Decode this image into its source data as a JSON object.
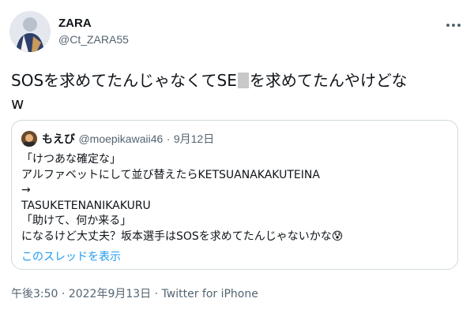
{
  "author": {
    "display_name": "ZARA",
    "handle": "@Ct_ZARA55"
  },
  "tweet": {
    "text_before": "SOSを求めてたんじゃなくてSE",
    "text_after": "を求めてたんやけどな",
    "text_line2": "w"
  },
  "quote": {
    "name": "もえび",
    "handle": "@moepikawaii46",
    "separator": "·",
    "date": "9月12日",
    "lines": [
      "「けつあな確定な」",
      "アルファベットにして並び替えたらKETSUANAKAKUTEINA",
      "→",
      "TASUKETENANIKAKURU",
      "「助けて、何か来る」",
      "になるけど大丈夫？坂本選手はSOSを求めてたんじゃないかな😰"
    ],
    "thread_link": "このスレッドを表示"
  },
  "meta": {
    "time": "午後3:50",
    "separator1": "·",
    "date": "2022年9月13日",
    "separator2": "·",
    "source": "Twitter for iPhone"
  },
  "icons": {
    "more": "more-options-icon"
  },
  "colors": {
    "link": "#1d9bf0",
    "secondary_text": "#536471",
    "border": "#cfd9de"
  }
}
